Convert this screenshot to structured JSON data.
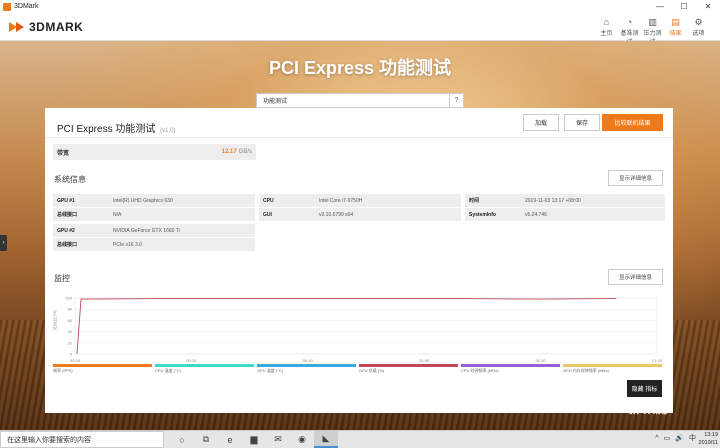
{
  "window": {
    "title": "3DMark",
    "controls": [
      "—",
      "☐",
      "✕"
    ]
  },
  "app": {
    "logo": "3DMARK",
    "nav": [
      {
        "label": "主页",
        "icon": "home-icon",
        "glyph": "⌂"
      },
      {
        "label": "基准测试",
        "icon": "gauge-icon",
        "glyph": "◔"
      },
      {
        "label": "压力测试",
        "icon": "stress-icon",
        "glyph": "▥"
      },
      {
        "label": "结果",
        "icon": "results-icon",
        "glyph": "▤",
        "active": true
      },
      {
        "label": "选项",
        "icon": "gear-icon",
        "glyph": "⚙"
      }
    ]
  },
  "banner": {
    "title": "PCI Express 功能测试"
  },
  "test_select": {
    "value": "功能测试",
    "help": "?"
  },
  "panel": {
    "title": "PCI Express 功能测试",
    "version": "(v1.0)",
    "buttons": {
      "load": "加载",
      "save": "保存",
      "compare": "比较联机结果"
    },
    "score": {
      "label": "带宽",
      "value": "12.17",
      "unit": "GB/s"
    },
    "system_info": {
      "title": "系统信息",
      "detail_button": "显示详细信息",
      "rows": [
        {
          "k": "GPU #1",
          "v": "Intel(R) UHD Graphics 630"
        },
        {
          "k": "总线接口",
          "v": "N/A"
        },
        {
          "k": "GPU #2",
          "v": "NVIDIA GeForce GTX 1660 Ti"
        },
        {
          "k": "总线接口",
          "v": "PCIe x16 3.0"
        },
        {
          "k": "CPU",
          "v": "Intel Core i7-9750H"
        },
        {
          "k": "GUI",
          "v": "v2.10.6799 s64"
        },
        {
          "k": "时间",
          "v": "2019-11-03 13:17 +08:00"
        },
        {
          "k": "SystemInfo",
          "v": "v5.24.746"
        }
      ]
    },
    "monitor": {
      "title": "监控",
      "detail_button": "显示详细信息",
      "hide_button": "隐藏 指标"
    }
  },
  "chart_data": {
    "type": "line",
    "ylabel": "百分比 (%)",
    "ylim": [
      0,
      100
    ],
    "yticks": [
      "100",
      "80",
      "60",
      "40",
      "20",
      "0"
    ],
    "x": [
      "00:00",
      "00:20",
      "00:40",
      "01:00",
      "01:20",
      "01:40"
    ],
    "series": [
      {
        "name": "帧率 (FPS)",
        "color": "#c0485a",
        "values": [
          0,
          98,
          99,
          99,
          99,
          99,
          99,
          98,
          99
        ]
      }
    ],
    "legend": [
      {
        "name": "帧率 (FPS)",
        "color": "#f07a19"
      },
      {
        "name": "CPU 温度 (°C)",
        "color": "#3fd9c7"
      },
      {
        "name": "GPU 温度 (°C)",
        "color": "#38a8e0"
      },
      {
        "name": "GPU 负载 (%)",
        "color": "#c0485a"
      },
      {
        "name": "CPU 时钟频率 (MHz)",
        "color": "#9a5fd6"
      },
      {
        "name": "GPU 内存时钟频率 (MHz)",
        "color": "#e8c86a"
      }
    ]
  },
  "taskbar": {
    "search_placeholder": "在这里输入你要搜索的内容",
    "icons": [
      {
        "name": "cortana-icon",
        "glyph": "○"
      },
      {
        "name": "task-view-icon",
        "glyph": "⧉"
      },
      {
        "name": "edge-icon",
        "glyph": "e"
      },
      {
        "name": "explorer-icon",
        "glyph": "▆"
      },
      {
        "name": "mail-icon",
        "glyph": "✉"
      },
      {
        "name": "chrome-icon",
        "glyph": "◉"
      },
      {
        "name": "3dmark-taskbar-icon",
        "glyph": "◣",
        "active": true
      }
    ],
    "tray": [
      "^",
      "▭",
      "🔊",
      "中"
    ],
    "time": "13:19",
    "date": "2019/11"
  },
  "watermark": "新 众测"
}
